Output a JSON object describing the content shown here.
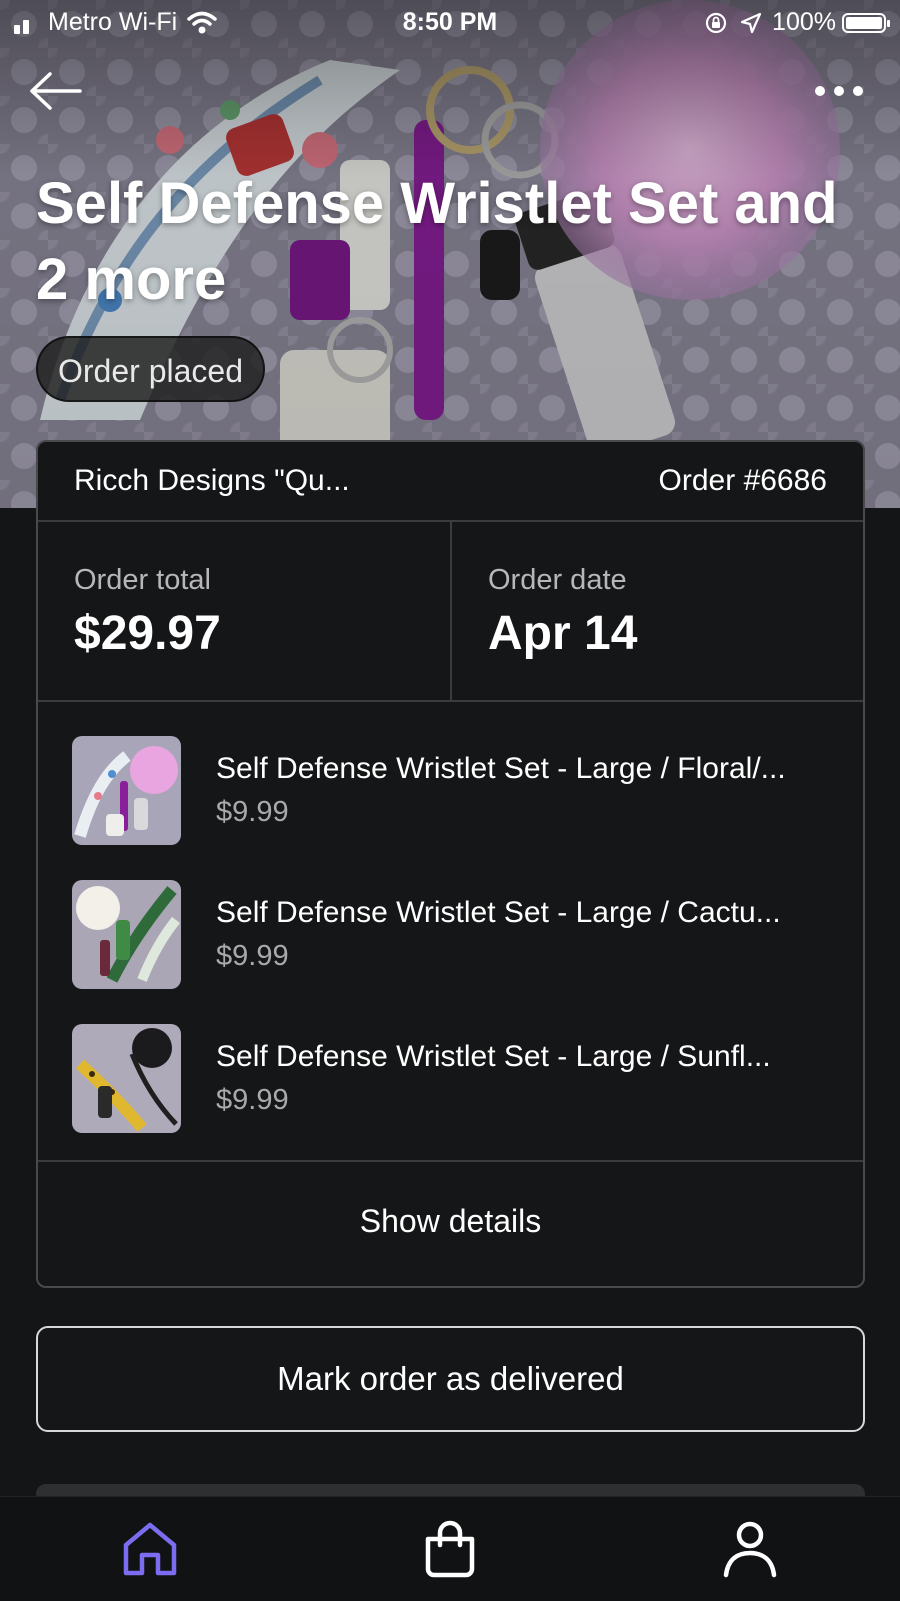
{
  "status_bar": {
    "carrier": "Metro Wi-Fi",
    "time": "8:50 PM",
    "battery_percent": "100%"
  },
  "header": {
    "title": "Self Defense Wristlet Set and 2 more",
    "status_badge": "Order placed"
  },
  "order": {
    "store_name": "Ricch Designs \"Qu...",
    "order_number": "Order #6686",
    "total_label": "Order total",
    "total_value": "$29.97",
    "date_label": "Order date",
    "date_value": "Apr 14",
    "items": [
      {
        "name": "Self Defense Wristlet Set - Large / Floral/...",
        "price": "$9.99"
      },
      {
        "name": "Self Defense Wristlet Set - Large / Cactu...",
        "price": "$9.99"
      },
      {
        "name": "Self Defense Wristlet Set - Large / Sunfl...",
        "price": "$9.99"
      }
    ],
    "show_details_label": "Show details"
  },
  "actions": {
    "mark_delivered_label": "Mark order as delivered"
  },
  "tab_bar": {
    "items": [
      {
        "icon": "home-icon",
        "active": true
      },
      {
        "icon": "shopping-bag-icon",
        "active": false
      },
      {
        "icon": "person-icon",
        "active": false
      }
    ]
  },
  "colors": {
    "background": "#141516",
    "card_border": "#4a4a4c",
    "active_tab": "#7b6cf0",
    "secondary_text": "#b7b7b9"
  }
}
